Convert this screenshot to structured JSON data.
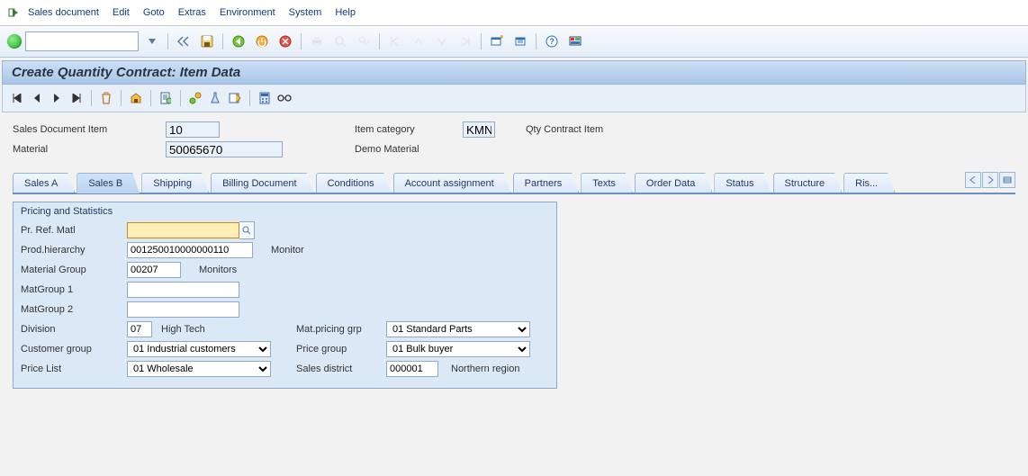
{
  "menu": {
    "items": [
      "Sales document",
      "Edit",
      "Goto",
      "Extras",
      "Environment",
      "System",
      "Help"
    ]
  },
  "title": "Create Quantity Contract: Item Data",
  "header": {
    "item_label": "Sales Document Item",
    "item_value": "10",
    "cat_label": "Item category",
    "cat_value": "KMN",
    "cat_text": "Qty Contract Item",
    "material_label": "Material",
    "material_value": "50065670",
    "material_text": "Demo Material"
  },
  "tabs": [
    "Sales A",
    "Sales B",
    "Shipping",
    "Billing Document",
    "Conditions",
    "Account assignment",
    "Partners",
    "Texts",
    "Order Data",
    "Status",
    "Structure",
    "Ris..."
  ],
  "active_tab": 1,
  "group": {
    "title": "Pricing and Statistics",
    "pr_ref_label": "Pr. Ref. Matl",
    "pr_ref_value": "",
    "prod_h_label": "Prod.hierarchy",
    "prod_h_value": "001250010000000110",
    "prod_h_text": "Monitor",
    "matgrp_label": "Material Group",
    "matgrp_value": "00207",
    "matgrp_text": "Monitors",
    "mg1_label": "MatGroup 1",
    "mg1_value": "",
    "mg2_label": "MatGroup 2",
    "mg2_value": "",
    "div_label": "Division",
    "div_value": "07",
    "div_text": "High Tech",
    "cust_label": "Customer group",
    "cust_value": "01 Industrial customers",
    "price_list_label": "Price List",
    "price_list_value": "01 Wholesale",
    "mat_grp_label": "Mat.pricing grp",
    "mat_grp_value": "01 Standard Parts",
    "price_grp_label": "Price group",
    "price_grp_value": "01 Bulk buyer",
    "sales_dist_label": "Sales district",
    "sales_dist_value": "000001",
    "sales_dist_text": "Northern region"
  }
}
